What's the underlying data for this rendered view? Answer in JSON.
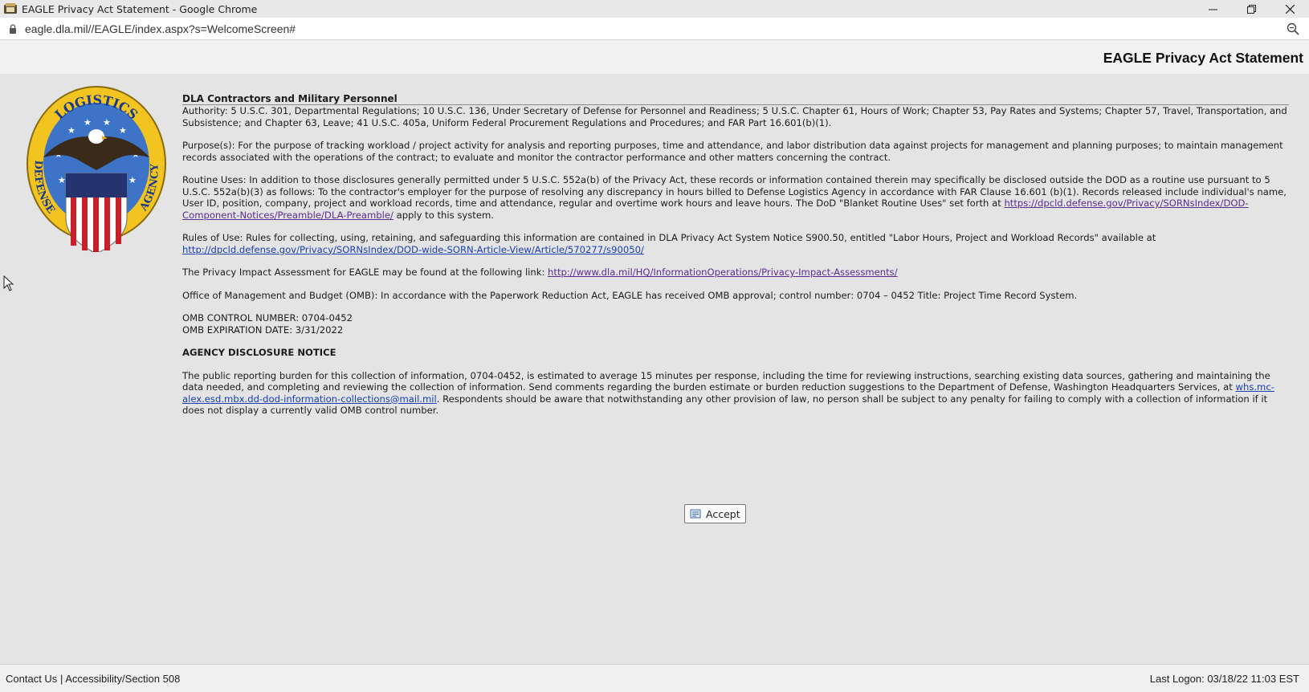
{
  "window": {
    "title": "EAGLE Privacy Act Statement - Google Chrome",
    "url": "eagle.dla.mil//EAGLE/index.aspx?s=WelcomeScreen#"
  },
  "header": {
    "title": "EAGLE Privacy Act Statement"
  },
  "statement": {
    "section_title": "DLA Contractors and Military Personnel",
    "authority": "Authority: 5 U.S.C. 301, Departmental Regulations; 10 U.S.C. 136, Under Secretary of Defense for Personnel and Readiness; 5 U.S.C. Chapter 61, Hours of Work; Chapter 53, Pay Rates and Systems; Chapter 57, Travel, Transportation, and Subsistence; and Chapter 63, Leave; 41 U.S.C. 405a, Uniform Federal Procurement Regulations and Procedures; and FAR Part 16.601(b)(1).",
    "purpose": "Purpose(s): For the purpose of tracking workload / project activity for analysis and reporting purposes, time and attendance, and labor distribution data against projects for management and planning purposes; to maintain management records associated with the operations of the contract; to evaluate and monitor the contractor performance and other matters concerning the contract.",
    "routine_uses_text": "Routine Uses: In addition to those disclosures generally permitted under 5 U.S.C. 552a(b) of the Privacy Act, these records or information contained therein may specifically be disclosed outside the DOD as a routine use pursuant to 5 U.S.C. 552a(b)(3) as follows: To the contractor's employer for the purpose of resolving any discrepancy in hours billed to Defense Logistics Agency in accordance with FAR Clause 16.601 (b)(1). Records released include individual's name, User ID, position, company, project and workload records, time and attendance, regular and overtime work hours and leave hours. The DoD \"Blanket Routine Uses\" set forth at ",
    "routine_uses_link": "https://dpcld.defense.gov/Privacy/SORNsIndex/DOD-Component-Notices/Preamble/DLA-Preamble/",
    "routine_uses_tail": " apply to this system.",
    "rules_text": "Rules of Use: Rules for collecting, using, retaining, and safeguarding this information are contained in DLA Privacy Act System Notice S900.50, entitled \"Labor Hours, Project and Workload Records\" available at",
    "rules_link": "http://dpcld.defense.gov/Privacy/SORNsIndex/DOD-wide-SORN-Article-View/Article/570277/s90050/",
    "pia_text": "The Privacy Impact Assessment for EAGLE may be found at the following link: ",
    "pia_link": "http://www.dla.mil/HQ/InformationOperations/Privacy-Impact-Assessments/",
    "omb_text": "Office of Management and Budget (OMB): In accordance with the Paperwork Reduction Act, EAGLE has received OMB approval; control number: 0704 – 0452 Title: Project Time Record System.",
    "omb_control": "OMB CONTROL NUMBER: 0704-0452",
    "omb_expiration": "OMB EXPIRATION DATE: 3/31/2022",
    "notice_title": "AGENCY DISCLOSURE NOTICE",
    "notice_text": "The public reporting burden for this collection of information, 0704-0452, is estimated to average 15 minutes per response, including the time for reviewing instructions, searching existing data sources, gathering and maintaining the data needed, and completing and reviewing the collection of information. Send comments regarding the burden estimate or burden reduction suggestions to the Department of Defense, Washington Headquarters Services, at ",
    "notice_link": "whs.mc-alex.esd.mbx.dd-dod-information-collections@mail.mil",
    "notice_tail": ". Respondents should be aware that notwithstanding any other provision of law, no person shall be subject to any penalty for failing to comply with a collection of information if it does not display a currently valid OMB control number."
  },
  "accept_button": {
    "label": "Accept",
    "icon": "accept-icon"
  },
  "logo": {
    "text_top": "LOGISTICS",
    "text_left": "DEFENSE",
    "text_right": "AGENCY"
  },
  "footer": {
    "contact": "Contact Us",
    "separator": "|",
    "accessibility": "Accessibility/Section 508",
    "last_logon": "Last Logon: 03/18/22 11:03 EST"
  },
  "colors": {
    "link_visited": "#5a2d91",
    "link": "#1a3fb0",
    "background": "#e4e4e4"
  }
}
